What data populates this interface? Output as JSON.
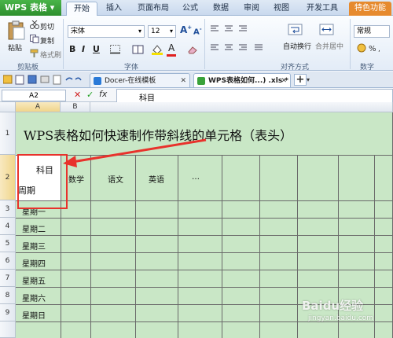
{
  "app": {
    "name": "WPS 表格"
  },
  "ribbon_tabs": [
    "开始",
    "插入",
    "页面布局",
    "公式",
    "数据",
    "审阅",
    "视图",
    "开发工具",
    "特色功能"
  ],
  "clipboard": {
    "paste": "粘贴",
    "cut": "剪切",
    "copy": "复制",
    "format_painter": "格式刷",
    "group": "剪贴板"
  },
  "font": {
    "name": "宋体",
    "size": "12",
    "bold": "B",
    "italic": "I",
    "underline": "U",
    "group": "字体"
  },
  "align": {
    "wrap": "自动换行",
    "merge": "合并居中",
    "group": "对齐方式"
  },
  "number": {
    "group": "数字",
    "format": "常规"
  },
  "doc_tabs": {
    "template": "Docer-在线模板",
    "file": "WPS表格如何...) .xls *"
  },
  "formula_bar": {
    "namebox": "A2",
    "content_line1": "科目",
    "content_line2": "周期"
  },
  "grid": {
    "columns": [
      "A",
      "B"
    ],
    "rows": [
      "1",
      "2",
      "3",
      "4",
      "5",
      "6",
      "7",
      "8",
      "9"
    ],
    "title": "WPS表格如何快速制作带斜线的单元格（表头）",
    "header_subject": "科目",
    "header_period": "周期",
    "subjects": [
      "数学",
      "语文",
      "英语",
      "…"
    ],
    "days": [
      "星期一",
      "星期二",
      "星期三",
      "星期四",
      "星期五",
      "星期六",
      "星期日"
    ]
  },
  "watermark": {
    "text": "Baidu经验",
    "url": "jingyan.baidu.com"
  }
}
